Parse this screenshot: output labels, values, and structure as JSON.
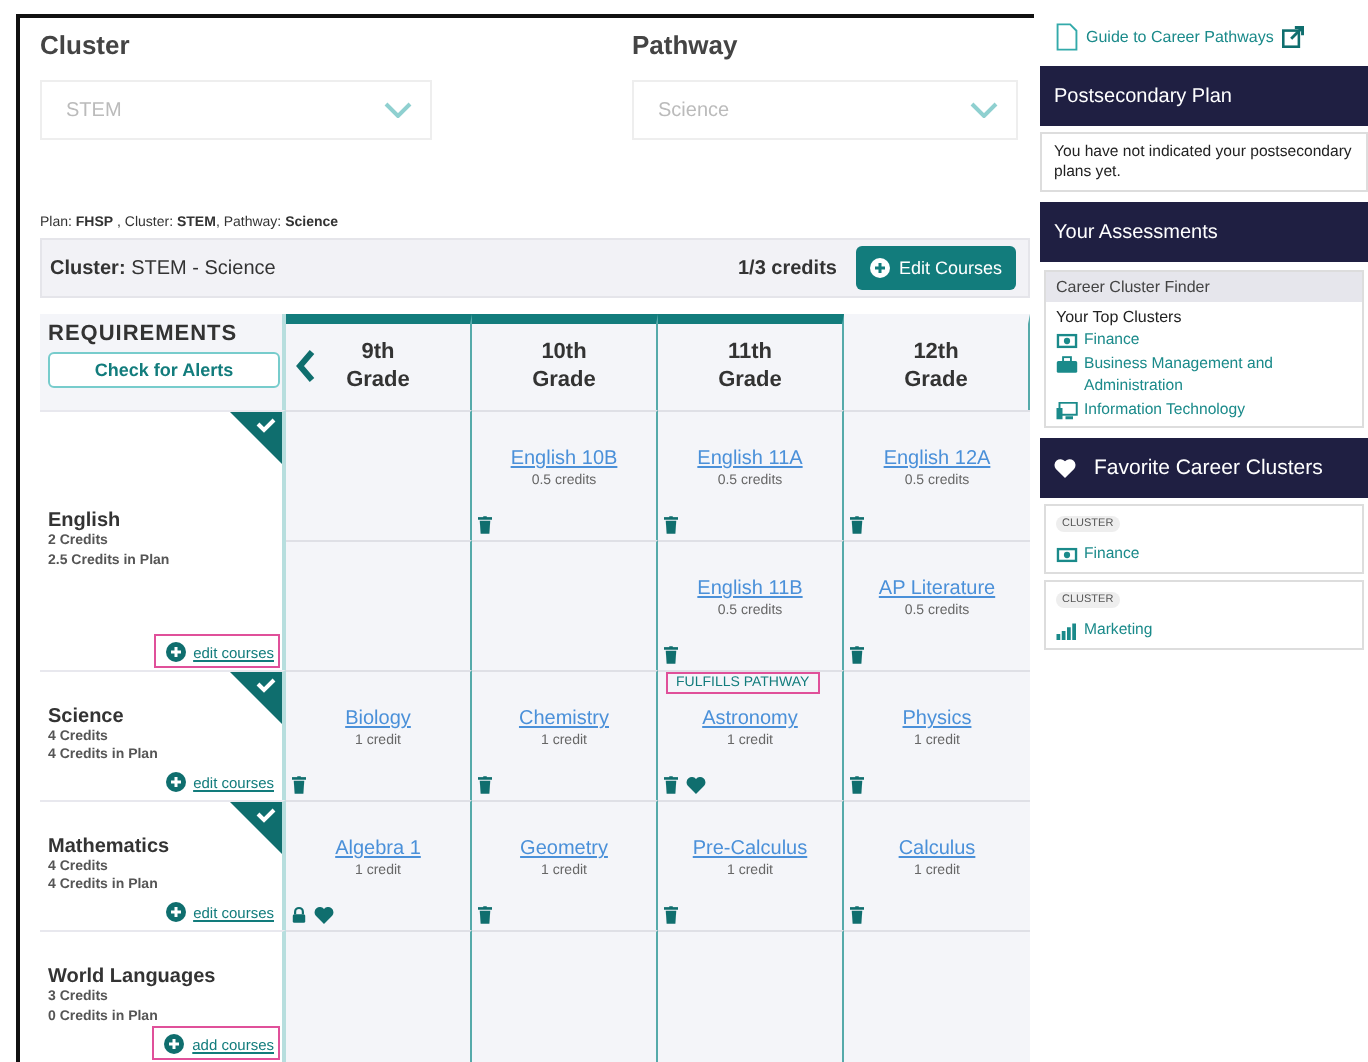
{
  "selectors": [
    {
      "label": "Cluster",
      "value": "STEM"
    },
    {
      "label": "Pathway",
      "value": "Science"
    }
  ],
  "summary": "Plan: **FHSP** , Cluster: **STEM**, Pathway: **Science**",
  "cluster_bar": {
    "title": "**Cluster:** STEM - Science",
    "credits": "1/3 credits",
    "button": "Edit Courses"
  },
  "requirements_header": {
    "title": "REQUIREMENTS",
    "button": "Check for Alerts"
  },
  "grades": [
    {
      "label": "9th Grade",
      "in_range": true
    },
    {
      "label": "10th Grade",
      "in_range": true
    },
    {
      "label": "11th Grade",
      "in_range": true
    },
    {
      "label": "12th Grade",
      "in_range": false
    }
  ],
  "requirements": [
    {
      "name": "English",
      "credits": "2 Credits",
      "planned": "2.5 Credits in Plan",
      "met": true,
      "link": "edit courses",
      "highlighted": true,
      "rows": [
        [
          null,
          {
            "course": "English 10B",
            "credits": "0.5 credits",
            "removable": true,
            "locked": false,
            "favorite": false
          },
          {
            "course": "English 11A",
            "credits": "0.5 credits",
            "removable": true,
            "locked": false,
            "favorite": false
          },
          {
            "course": "English 12A",
            "credits": "0.5 credits",
            "removable": true,
            "locked": false,
            "favorite": false
          }
        ],
        [
          null,
          null,
          {
            "course": "English 11B",
            "credits": "0.5 credits",
            "removable": true,
            "locked": false,
            "favorite": false
          },
          {
            "course": "AP Literature",
            "credits": "0.5 credits",
            "removable": true,
            "locked": false,
            "favorite": false
          }
        ]
      ]
    },
    {
      "name": "Science",
      "credits": "4 Credits",
      "planned": "4 Credits in Plan",
      "met": true,
      "link": "edit courses",
      "highlighted": false,
      "rows": [
        [
          {
            "course": "Biology",
            "credits": "1 credit",
            "removable": true,
            "locked": false,
            "favorite": false
          },
          {
            "course": "Chemistry",
            "credits": "1 credit",
            "removable": true,
            "locked": false,
            "favorite": false
          },
          {
            "course": "Astronomy",
            "credits": "1 credit",
            "removable": true,
            "locked": false,
            "favorite": true,
            "badge": "FULFILLS PATHWAY"
          },
          {
            "course": "Physics",
            "credits": "1 credit",
            "removable": true,
            "locked": false,
            "favorite": false
          }
        ]
      ]
    },
    {
      "name": "Mathematics",
      "credits": "4 Credits",
      "planned": "4 Credits in Plan",
      "met": true,
      "link": "edit courses",
      "highlighted": false,
      "rows": [
        [
          {
            "course": "Algebra 1",
            "credits": "1 credit",
            "removable": false,
            "locked": true,
            "favorite": true
          },
          {
            "course": "Geometry",
            "credits": "1 credit",
            "removable": true,
            "locked": false,
            "favorite": false
          },
          {
            "course": "Pre-Calculus",
            "credits": "1 credit",
            "removable": true,
            "locked": false,
            "favorite": false
          },
          {
            "course": "Calculus",
            "credits": "1 credit",
            "removable": true,
            "locked": false,
            "favorite": false
          }
        ]
      ]
    },
    {
      "name": "World Languages",
      "credits": "3 Credits",
      "planned": "0 Credits in Plan",
      "met": false,
      "link": "add courses",
      "highlighted": true,
      "rows": [
        [
          null,
          null,
          null,
          null
        ]
      ]
    }
  ],
  "sidebar": {
    "guide_link": "Guide to Career Pathways",
    "postsecondary": {
      "title": "Postsecondary Plan",
      "text": "You have not indicated your postsecondary plans yet."
    },
    "assessments": {
      "title": "Your Assessments",
      "card_title": "Career Cluster Finder",
      "subtitle": "Your Top Clusters",
      "clusters": [
        "Finance",
        "Business Management and Administration",
        "Information Technology"
      ]
    },
    "favorites": {
      "title": "Favorite Career Clusters",
      "items": [
        {
          "tag": "CLUSTER",
          "name": "Finance"
        },
        {
          "tag": "CLUSTER",
          "name": "Marketing"
        }
      ]
    }
  }
}
